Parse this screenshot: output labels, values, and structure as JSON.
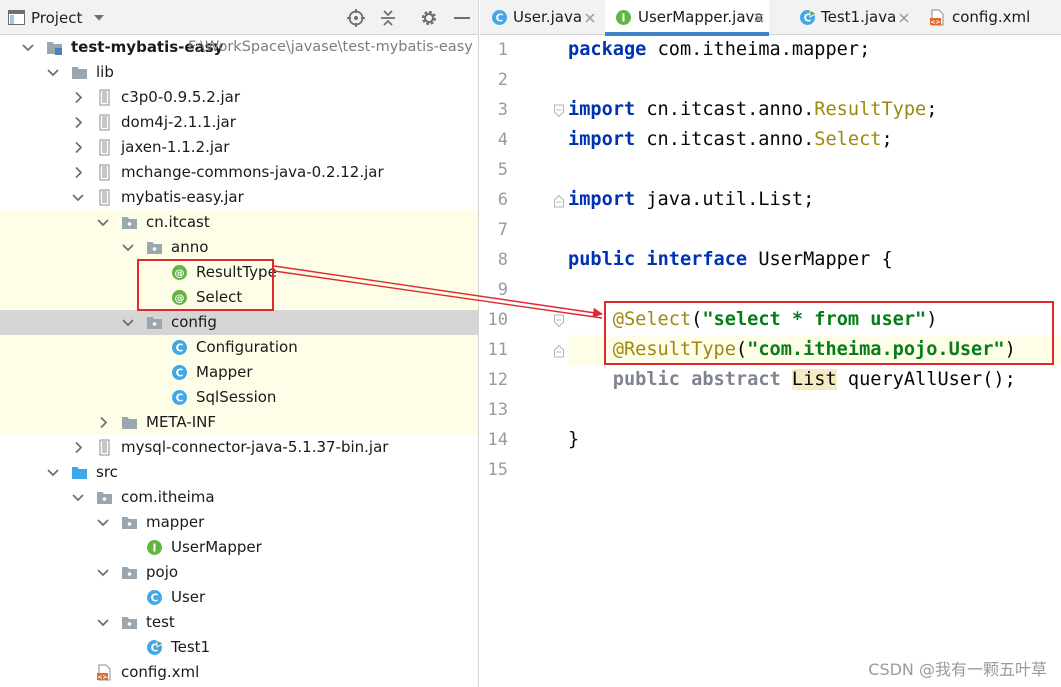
{
  "project_panel": {
    "title": "Project",
    "toolbar_icons": [
      "locate-icon",
      "collapse-all-icon",
      "gear-icon",
      "minimize-icon"
    ]
  },
  "tree": [
    {
      "label": "test-mybatis-easy",
      "path": "F:\\WorkSpace\\javase\\test-mybatis-easy",
      "icon": "module-folder-icon",
      "expanded": true,
      "bold": true
    },
    {
      "label": "lib",
      "icon": "folder-icon",
      "expanded": true
    },
    {
      "label": "c3p0-0.9.5.2.jar",
      "icon": "jar-icon",
      "expanded": false
    },
    {
      "label": "dom4j-2.1.1.jar",
      "icon": "jar-icon",
      "expanded": false
    },
    {
      "label": "jaxen-1.1.2.jar",
      "icon": "jar-icon",
      "expanded": false
    },
    {
      "label": "mchange-commons-java-0.2.12.jar",
      "icon": "jar-icon",
      "expanded": false
    },
    {
      "label": "mybatis-easy.jar",
      "icon": "jar-icon",
      "expanded": true
    },
    {
      "label": "cn.itcast",
      "icon": "package-icon",
      "expanded": true
    },
    {
      "label": "anno",
      "icon": "package-icon",
      "expanded": true
    },
    {
      "label": "ResultType",
      "icon": "annotation-icon"
    },
    {
      "label": "Select",
      "icon": "annotation-icon"
    },
    {
      "label": "config",
      "icon": "package-icon",
      "expanded": true,
      "selected": true
    },
    {
      "label": "Configuration",
      "icon": "class-icon"
    },
    {
      "label": "Mapper",
      "icon": "class-icon"
    },
    {
      "label": "SqlSession",
      "icon": "class-icon"
    },
    {
      "label": "META-INF",
      "icon": "folder-icon",
      "expanded": false
    },
    {
      "label": "mysql-connector-java-5.1.37-bin.jar",
      "icon": "jar-icon",
      "expanded": false
    },
    {
      "label": "src",
      "icon": "source-folder-icon",
      "expanded": true
    },
    {
      "label": "com.itheima",
      "icon": "package-icon",
      "expanded": true
    },
    {
      "label": "mapper",
      "icon": "package-icon",
      "expanded": true
    },
    {
      "label": "UserMapper",
      "icon": "interface-icon"
    },
    {
      "label": "pojo",
      "icon": "package-icon",
      "expanded": true
    },
    {
      "label": "User",
      "icon": "class-icon"
    },
    {
      "label": "test",
      "icon": "package-icon",
      "expanded": true
    },
    {
      "label": "Test1",
      "icon": "runnable-class-icon"
    },
    {
      "label": "config.xml",
      "icon": "xml-file-icon"
    }
  ],
  "tabs": [
    {
      "label": "User.java",
      "icon": "class-icon",
      "active": false
    },
    {
      "label": "UserMapper.java",
      "icon": "interface-icon",
      "active": true
    },
    {
      "label": "Test1.java",
      "icon": "runnable-class-icon",
      "active": false
    },
    {
      "label": "config.xml",
      "icon": "xml-file-icon",
      "active": false
    }
  ],
  "editor": {
    "line_numbers": [
      "1",
      "2",
      "3",
      "4",
      "5",
      "6",
      "7",
      "8",
      "9",
      "10",
      "11",
      "12",
      "13",
      "14",
      "15"
    ],
    "code": {
      "l1_kw": "package",
      "l1_rest": " com.itheima.mapper;",
      "l3_kw": "import",
      "l3_pkg": " cn.itcast.anno.",
      "l3_cls": "ResultType",
      "l3_end": ";",
      "l4_kw": "import",
      "l4_pkg": " cn.itcast.anno.",
      "l4_cls": "Select",
      "l4_end": ";",
      "l6_kw": "import",
      "l6_rest": " java.util.List;",
      "l8_kw1": "public",
      "l8_kw2": "interface",
      "l8_rest": " UserMapper {",
      "l10_ann": "@Select",
      "l10_open": "(",
      "l10_str": "\"select * from user\"",
      "l10_close": ")",
      "l11_ann": "@ResultType",
      "l11_open": "(",
      "l11_str": "\"com.itheima.pojo.User\"",
      "l11_close": ")",
      "l12_kw1": "public",
      "l12_kw2": "abstract",
      "l12_type": "List",
      "l12_rest": " queryAllUser();",
      "l14": "}"
    },
    "intention_icon": "lightbulb-icon"
  },
  "watermark": "CSDN @我有一颗五叶草",
  "colors": {
    "keyword": "#0033b3",
    "annotation": "#9e880d",
    "string": "#067d17",
    "highlight_box": "#e0292d",
    "current_line": "#fdfde8",
    "selected_row": "#d5d5d5"
  }
}
